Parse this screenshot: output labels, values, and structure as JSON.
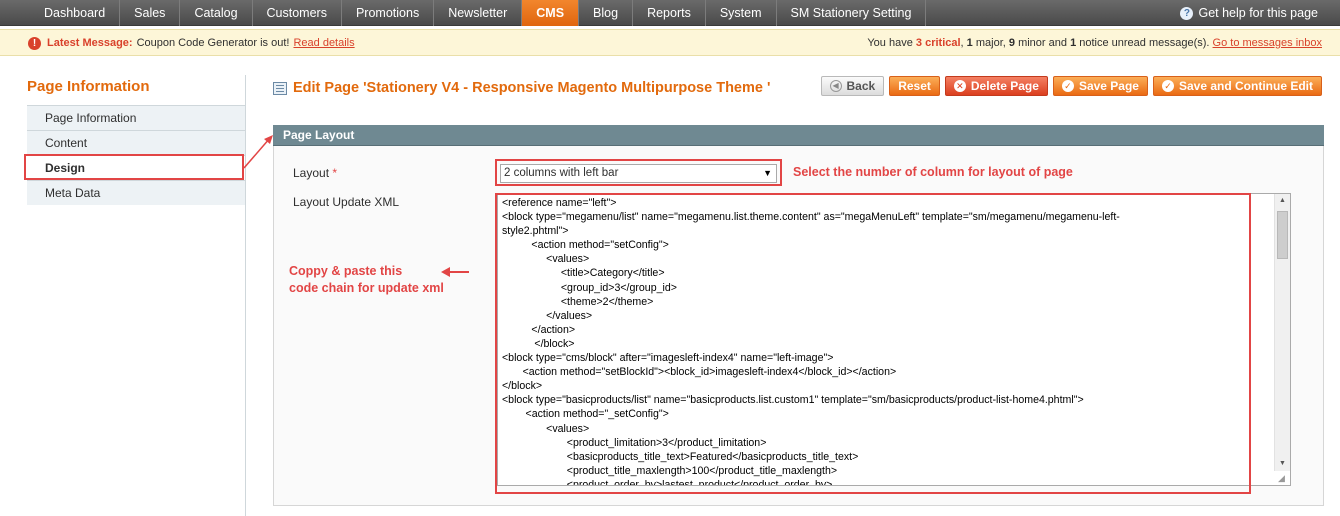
{
  "nav": {
    "items": [
      "Dashboard",
      "Sales",
      "Catalog",
      "Customers",
      "Promotions",
      "Newsletter",
      "CMS",
      "Blog",
      "Reports",
      "System",
      "SM Stationery Setting"
    ],
    "active_index": 6,
    "help": "Get help for this page"
  },
  "message": {
    "latest_label": "Latest Message:",
    "text": "Coupon Code Generator is out!",
    "link": "Read details",
    "summary_prefix": "You have",
    "critical_count": "3 critical",
    "major": "1",
    "major_text": "major,",
    "minor": "9",
    "minor_text": "minor and",
    "notice": "1",
    "notice_text": "notice unread message(s).",
    "inbox_link": "Go to messages inbox"
  },
  "sidebar": {
    "title": "Page Information",
    "tabs": [
      "Page Information",
      "Content",
      "Design",
      "Meta Data"
    ],
    "active_index": 2
  },
  "header": {
    "title": "Edit Page 'Stationery V4 - Responsive Magento Multipurpose Theme '"
  },
  "buttons": {
    "back": "Back",
    "reset": "Reset",
    "delete": "Delete Page",
    "save": "Save Page",
    "save_continue": "Save and Continue Edit"
  },
  "section": {
    "title": "Page Layout",
    "layout_label": "Layout",
    "layout_required": "*",
    "layout_value": "2 columns with left bar",
    "xml_label": "Layout Update XML",
    "xml_value": "<reference name=\"left\">\n<block type=\"megamenu/list\" name=\"megamenu.list.theme.content\" as=\"megaMenuLeft\" template=\"sm/megamenu/megamenu-left-\nstyle2.phtml\">\n          <action method=\"setConfig\">\n               <values>\n                    <title>Category</title>\n                    <group_id>3</group_id>\n                    <theme>2</theme>\n               </values>\n          </action>\n           </block>\n<block type=\"cms/block\" after=\"imagesleft-index4\" name=\"left-image\">\n       <action method=\"setBlockId\"><block_id>imagesleft-index4</block_id></action>\n</block>\n<block type=\"basicproducts/list\" name=\"basicproducts.list.custom1\" template=\"sm/basicproducts/product-list-home4.phtml\">\n        <action method=\"_setConfig\">\n               <values>\n                      <product_limitation>3</product_limitation>\n                      <basicproducts_title_text>Featured</basicproducts_title_text>\n                      <product_title_maxlength>100</product_title_maxlength>\n                      <product_order_by>lastest_product</product_order_by>"
  },
  "annotations": {
    "layout_note": "Select the number of column for layout of page",
    "copy_line1": "Coppy & paste this",
    "copy_line2": "code chain for update xml"
  },
  "colors": {
    "accent": "#e26a0d",
    "annotation": "#e24545",
    "section_header": "#6f8992"
  }
}
